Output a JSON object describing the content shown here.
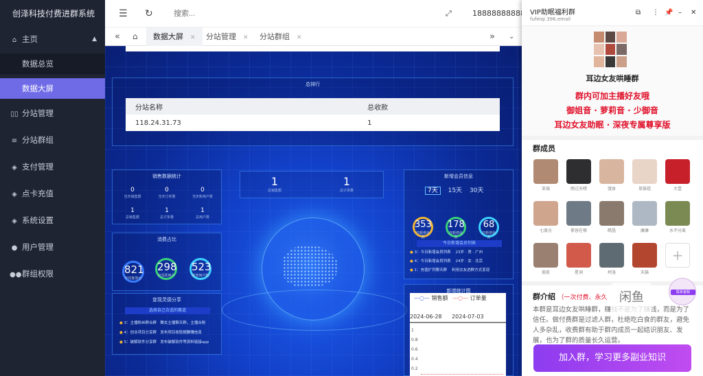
{
  "sidebar": {
    "brand": "创泽科技付费进群系统",
    "items": [
      {
        "label": "主页",
        "icon": "home-icon"
      },
      {
        "label": "数据总览",
        "icon": ""
      },
      {
        "label": "数据大屏",
        "icon": ""
      },
      {
        "label": "分站管理",
        "icon": "columns-icon"
      },
      {
        "label": "分站群组",
        "icon": "sliders-icon"
      },
      {
        "label": "支付管理",
        "icon": "shield-icon"
      },
      {
        "label": "点卡充值",
        "icon": "shield-icon"
      },
      {
        "label": "系统设置",
        "icon": "shield-icon"
      },
      {
        "label": "用户管理",
        "icon": "user-icon"
      },
      {
        "label": "群组权限",
        "icon": "users-icon"
      }
    ]
  },
  "topbar": {
    "search_placeholder": "搜索...",
    "username": "18888888888"
  },
  "tabs": [
    {
      "label": "数据大屏"
    },
    {
      "label": "分站管理"
    },
    {
      "label": "分站群组"
    }
  ],
  "dashboard": {
    "rank_title": "总排行",
    "rank_table": {
      "headers": [
        "分站名称",
        "总收款"
      ],
      "rows": [
        [
          "118.24.31.73",
          "1"
        ]
      ]
    },
    "sales_stats": {
      "title": "销售数据统计",
      "cells": [
        {
          "v": "0",
          "l": "当天销售额"
        },
        {
          "v": "0",
          "l": "当天订单量"
        },
        {
          "v": "0",
          "l": "当天新用户数"
        },
        {
          "v": "1",
          "l": "总销售额"
        },
        {
          "v": "1",
          "l": "总订单量"
        },
        {
          "v": "1",
          "l": "总用户数"
        }
      ]
    },
    "consumption": {
      "title": "消费占比",
      "rings": [
        {
          "v": "821",
          "l": "平均客单价"
        },
        {
          "v": "298",
          "l": "日活跃用户"
        },
        {
          "v": "523",
          "l": "新增用户数"
        }
      ]
    },
    "share": {
      "title": "变现灵感分享",
      "sub": "选择自己合适的赛道",
      "rows": [
        {
          "n": "3：",
          "a": "主播粉丝群合群",
          "b": "舞女主播聊天群，主播合粉"
        },
        {
          "n": "4：",
          "a": "创业项目分享群",
          "b": "发布项目收取报酬赚信息"
        },
        {
          "n": "5：",
          "a": "破解软件分享群",
          "b": "发布破解软件等资料链接app"
        }
      ]
    },
    "totals": [
      {
        "v": "1",
        "l": "总销售额"
      },
      {
        "v": "1",
        "l": "总订单量"
      }
    ],
    "new_members": {
      "title": "新增会员信息",
      "tabs": [
        "7天",
        "15天",
        "30天"
      ],
      "rings": [
        {
          "v": "353",
          "l": "日新增会员"
        },
        {
          "v": "178",
          "l": "日新增会员"
        },
        {
          "v": "68",
          "l": "日新增会员"
        }
      ],
      "list_title": "今日新增会员列表",
      "rows": [
        {
          "n": "3：",
          "a": "今日新增会员列表",
          "b": "23岁 · 男 · 广州"
        },
        {
          "n": "4：",
          "a": "今日新增会员列表",
          "b": "24岁 · 女 · 北京"
        },
        {
          "n": "1：",
          "a": "充值扩列聊天群",
          "b": "利用交友进群方式变现"
        }
      ]
    },
    "trend_title": "新增统计图",
    "trend_legend": [
      "销售额",
      "订单量"
    ],
    "trend_dates": [
      "2024-06-28",
      "2024-07-03"
    ],
    "trend_yticks": [
      "1",
      "0.8",
      "0.6",
      "0.4",
      "0.2",
      "0"
    ]
  },
  "overlay": {
    "title": "VIP助眠福利群",
    "email": "fufeiqi.396.email",
    "group_name": "耳边女友哄睡群",
    "promo_lines": [
      "群内可加主播好友哦",
      "御姐音 · 萝莉音 · 少御音",
      "耳边女友助眠 · 深夜专属尊享版"
    ],
    "members_title": "群成员",
    "members": [
      "亚璃",
      "雨过天晴",
      "饿食",
      "草猫祖",
      "大壹",
      "七度光",
      "拳容在哪",
      "睛晶",
      "康康",
      "水不分离",
      "美航",
      "星洞",
      "柯洛",
      "天猫"
    ],
    "intro_title": "群介绍",
    "intro_sub": "（一次付费、永久",
    "intro_text": "本群是耳边女友哄睡群，赚钱不是为了赚钱，而是为了信任。做付费群是过滤人群，杜绝吃白食的群友，避免人多杂乱，收费群有助于群内成员一起结识朋友、发展，也为了群的质量长久运营。",
    "watermark": "闲鱼",
    "support_label": "联系客服",
    "join_button": "加入群，学习更多副业知识"
  },
  "colors": {
    "accent": "#6f6be7",
    "sidebar": "#1f2433",
    "join": "#a545f0",
    "promo_red": "#e0102a"
  }
}
